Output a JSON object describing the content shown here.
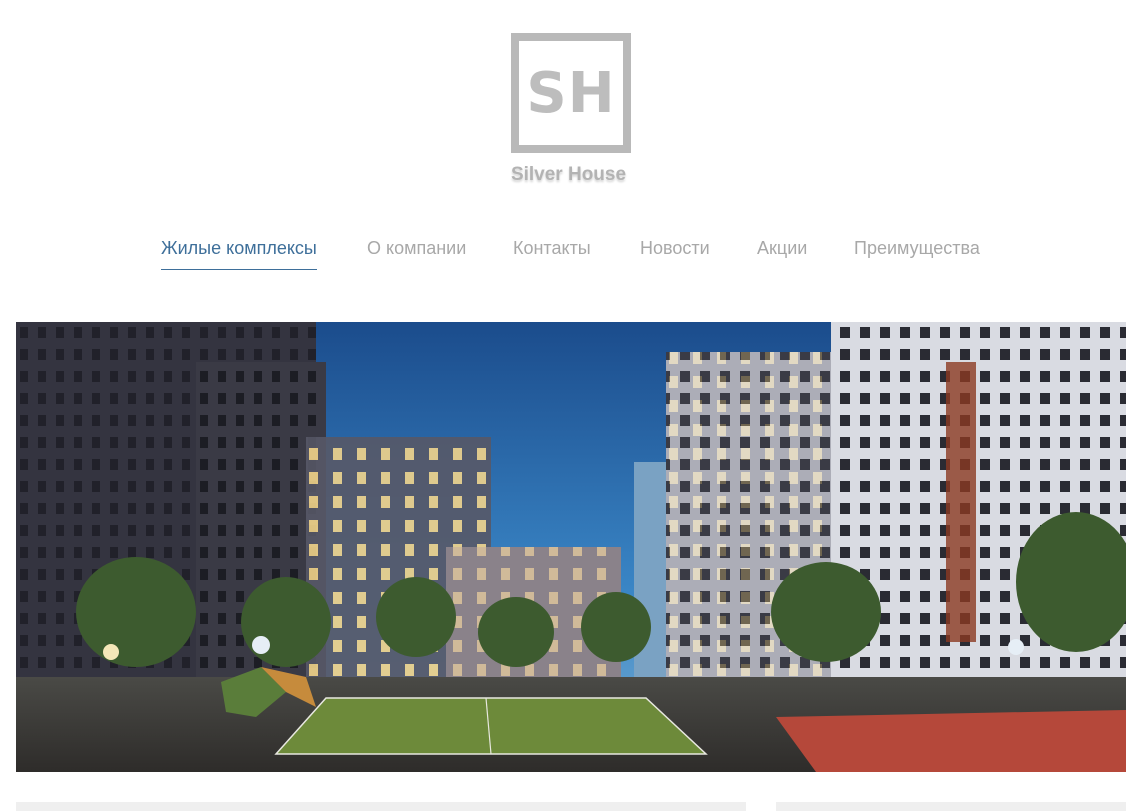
{
  "logo": {
    "letters": "SH",
    "name": "Silver House"
  },
  "nav": {
    "items": [
      {
        "label": "Жилые комплексы",
        "active": true
      },
      {
        "label": "О компании",
        "active": false
      },
      {
        "label": "Контакты",
        "active": false
      },
      {
        "label": "Новости",
        "active": false
      },
      {
        "label": "Акции",
        "active": false
      },
      {
        "label": "Преимущества",
        "active": false
      }
    ]
  },
  "colors": {
    "accent": "#3e6f9a",
    "nav_inactive": "#a8a8a8",
    "logo_gray": "#b9b9b9"
  }
}
